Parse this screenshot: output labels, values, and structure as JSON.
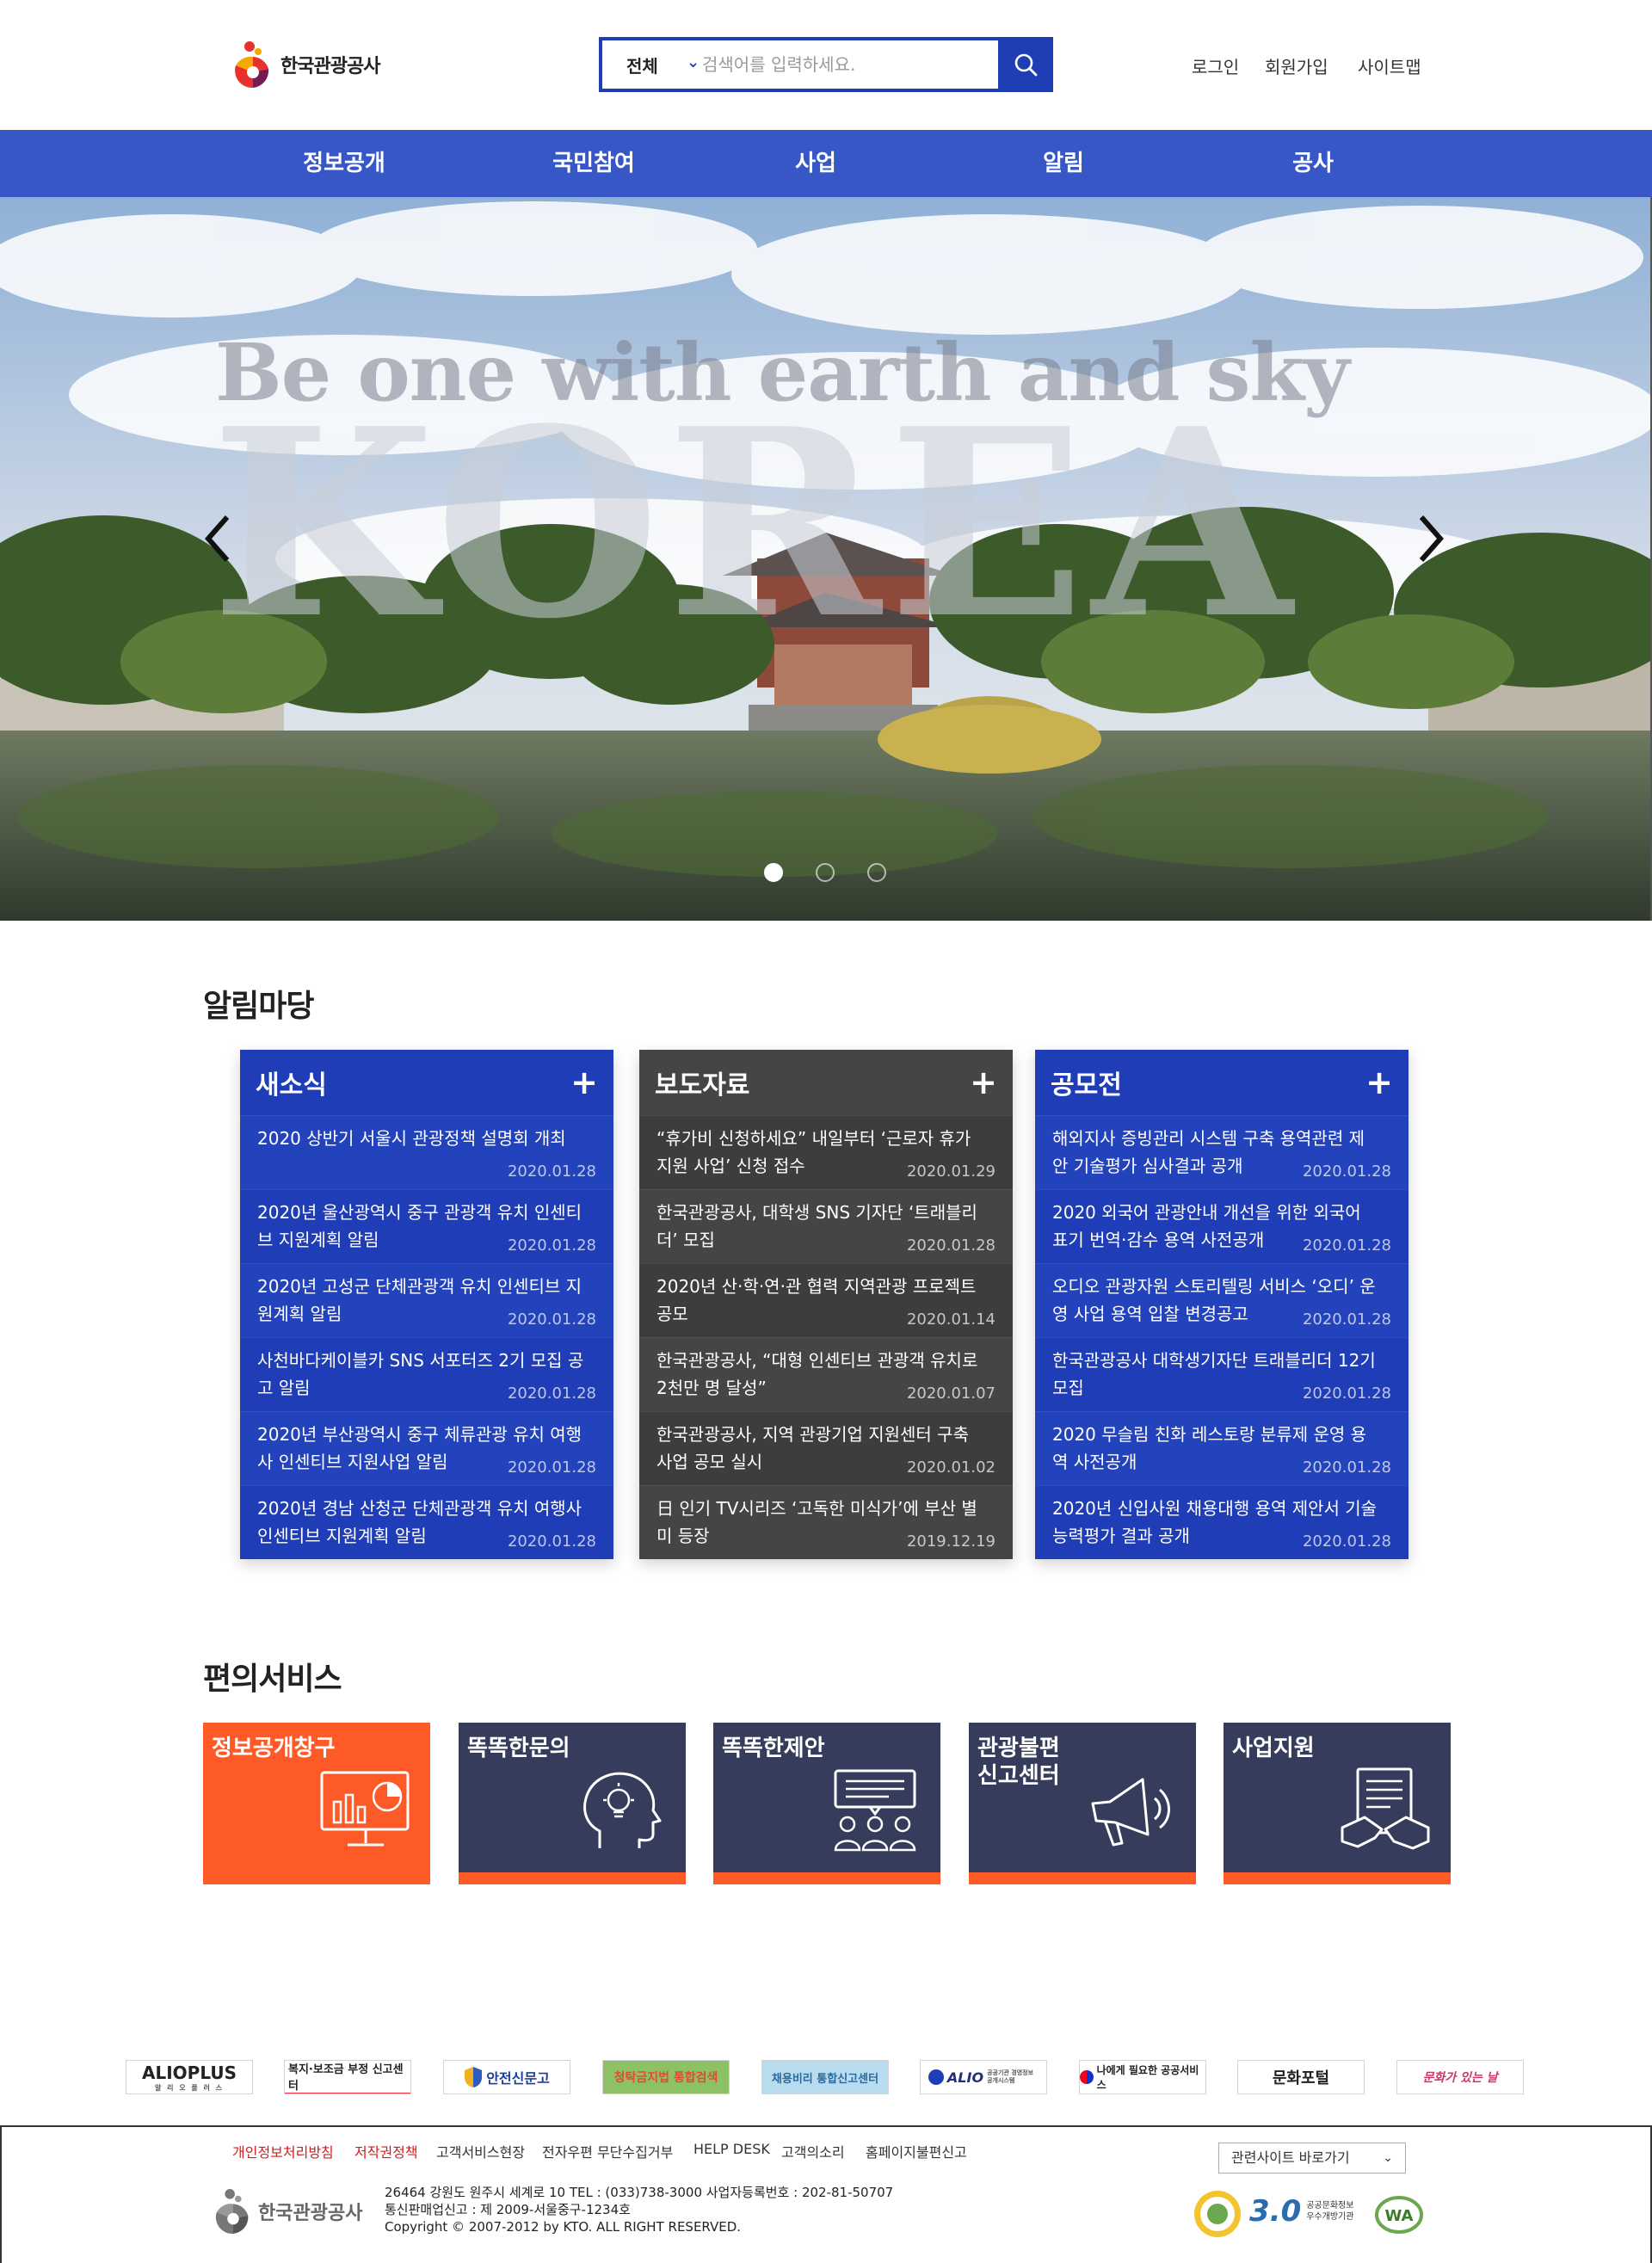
{
  "header": {
    "logo_text": "한국관광공사",
    "search": {
      "category": "전체",
      "placeholder": "검색어를 입력하세요."
    },
    "util_links": [
      "로그인",
      "회원가입",
      "사이트맵"
    ]
  },
  "gnb": [
    "정보공개",
    "국민참여",
    "사업",
    "알림",
    "공사"
  ],
  "hero": {
    "tagline": "Be one with earth and sky",
    "word": "KOREA",
    "slide_count": 3,
    "active_slide": 1
  },
  "notice": {
    "title": "알림마당",
    "boards": [
      {
        "title": "새소식",
        "plus": "+",
        "items": [
          {
            "text": "2020 상반기 서울시 관광정책 설명회 개최",
            "date": "2020.01.28"
          },
          {
            "text": "2020년 울산광역시 중구 관광객 유치 인센티브 지원계획 알림",
            "date": "2020.01.28"
          },
          {
            "text": "2020년 고성군 단체관광객 유치 인센티브 지원계획 알림",
            "date": "2020.01.28"
          },
          {
            "text": "사천바다케이블카 SNS 서포터즈 2기 모집 공고 알림",
            "date": "2020.01.28"
          },
          {
            "text": "2020년 부산광역시 중구 체류관광 유치 여행사 인센티브 지원사업 알림",
            "date": "2020.01.28"
          },
          {
            "text": "2020년 경남 산청군 단체관광객 유치 여행사 인센티브 지원계획 알림",
            "date": "2020.01.28"
          }
        ]
      },
      {
        "title": "보도자료",
        "plus": "+",
        "items": [
          {
            "text": "“휴가비 신청하세요” 내일부터 ‘근로자 휴가지원 사업’ 신청 접수",
            "date": "2020.01.29"
          },
          {
            "text": "한국관광공사, 대학생 SNS 기자단 ‘트래블리더’ 모집",
            "date": "2020.01.28"
          },
          {
            "text": "2020년 산·학·연·관 협력 지역관광 프로젝트 공모",
            "date": "2020.01.14"
          },
          {
            "text": "한국관광공사, “대형 인센티브 관광객 유치로 2천만 명 달성”",
            "date": "2020.01.07"
          },
          {
            "text": "한국관광공사, 지역 관광기업 지원센터 구축 사업 공모 실시",
            "date": "2020.01.02"
          },
          {
            "text": "日 인기 TV시리즈 ‘고독한 미식가’에 부산 별미 등장",
            "date": "2019.12.19"
          }
        ]
      },
      {
        "title": "공모전",
        "plus": "+",
        "items": [
          {
            "text": "해외지사 증빙관리 시스템 구축 용역관련 제안 기술평가 심사결과 공개",
            "date": "2020.01.28"
          },
          {
            "text": "2020 외국어 관광안내 개선을 위한 외국어 표기 번역·감수 용역 사전공개",
            "date": "2020.01.28"
          },
          {
            "text": "오디오 관광자원 스토리텔링 서비스 ‘오디’ 운영 사업 용역 입찰 변경공고",
            "date": "2020.01.28"
          },
          {
            "text": "한국관광공사 대학생기자단 트래블리더 12기 모집",
            "date": "2020.01.28"
          },
          {
            "text": "2020 무슬림 친화 레스토랑 분류제 운영 용역 사전공개",
            "date": "2020.01.28"
          },
          {
            "text": "2020년 신입사원 채용대행 용역 제안서 기술능력평가 결과 공개",
            "date": "2020.01.28"
          }
        ]
      }
    ]
  },
  "services": {
    "title": "편의서비스",
    "items": [
      {
        "label": "정보공개창구",
        "icon": "monitor-chart-icon"
      },
      {
        "label": "똑똑한문의",
        "icon": "head-lightbulb-icon"
      },
      {
        "label": "똑똑한제안",
        "icon": "people-speech-icon"
      },
      {
        "label": "관광불편\n신고센터",
        "icon": "megaphone-icon"
      },
      {
        "label": "사업지원",
        "icon": "handshake-document-icon"
      }
    ]
  },
  "banners": [
    "ALIOPLUS",
    "복지·보조금 부정 신고센터",
    "안전신문고",
    "청탁금지법 통합검색",
    "채용비리 통합신고센터",
    "ALIO",
    "나에게 필요한 공공서비스",
    "문화포털",
    "문화가 있는 날"
  ],
  "banner_sub": {
    "alioplus": "알 리 오 플 러 스",
    "alio": "공공기관 경영정보 공개시스템"
  },
  "footer": {
    "links": [
      "개인정보처리방침",
      "저작권정책",
      "고객서비스현장",
      "전자우편 무단수집거부",
      "HELP DESK",
      "고객의소리",
      "홈페이지불편신고"
    ],
    "related_label": "관련사이트 바로가기",
    "logo_text": "한국관광공사",
    "address": "26464 강원도 원주시 세계로 10 TEL : (033)738-3000 사업자등록번호 : 202-81-50707",
    "registration": "통신판매업신고 : 제 2009-서울중구-1234호",
    "copyright": "Copyright © 2007-2012 by KTO. ALL RIGHT RESERVED.",
    "cert_gov30": "3.0",
    "cert_gov30_text": "공공문화정보 우수개방기관"
  },
  "colors": {
    "primary": "#1f3db6",
    "gnb": "#3857c6",
    "accent": "#fe5a28",
    "service_bg": "#353c5c",
    "dark_board": "#454545"
  }
}
